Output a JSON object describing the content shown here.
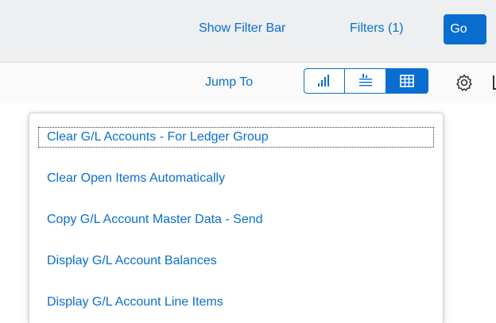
{
  "filterbar": {
    "show_filter_bar_label": "Show Filter Bar",
    "filters_label": "Filters (1)",
    "go_label": "Go"
  },
  "toolbar": {
    "jump_to_label": "Jump To",
    "view_buttons": [
      {
        "icon": "column-chart-icon",
        "selected": false
      },
      {
        "icon": "chart-table-icon",
        "selected": false
      },
      {
        "icon": "table-view-icon",
        "selected": true
      }
    ],
    "settings_icon": "gear-icon"
  },
  "menu": {
    "items": [
      {
        "label": "Clear G/L Accounts - For Ledger Group",
        "focused": true
      },
      {
        "label": "Clear Open Items Automatically",
        "focused": false
      },
      {
        "label": "Copy G/L Account Master Data - Send",
        "focused": false
      },
      {
        "label": "Display G/L Account Balances",
        "focused": false
      },
      {
        "label": "Display G/L Account Line Items",
        "focused": false
      }
    ]
  },
  "colors": {
    "accent": "#0a6ed1",
    "filterbar_bg": "#edeff0",
    "text": "#32363a"
  }
}
